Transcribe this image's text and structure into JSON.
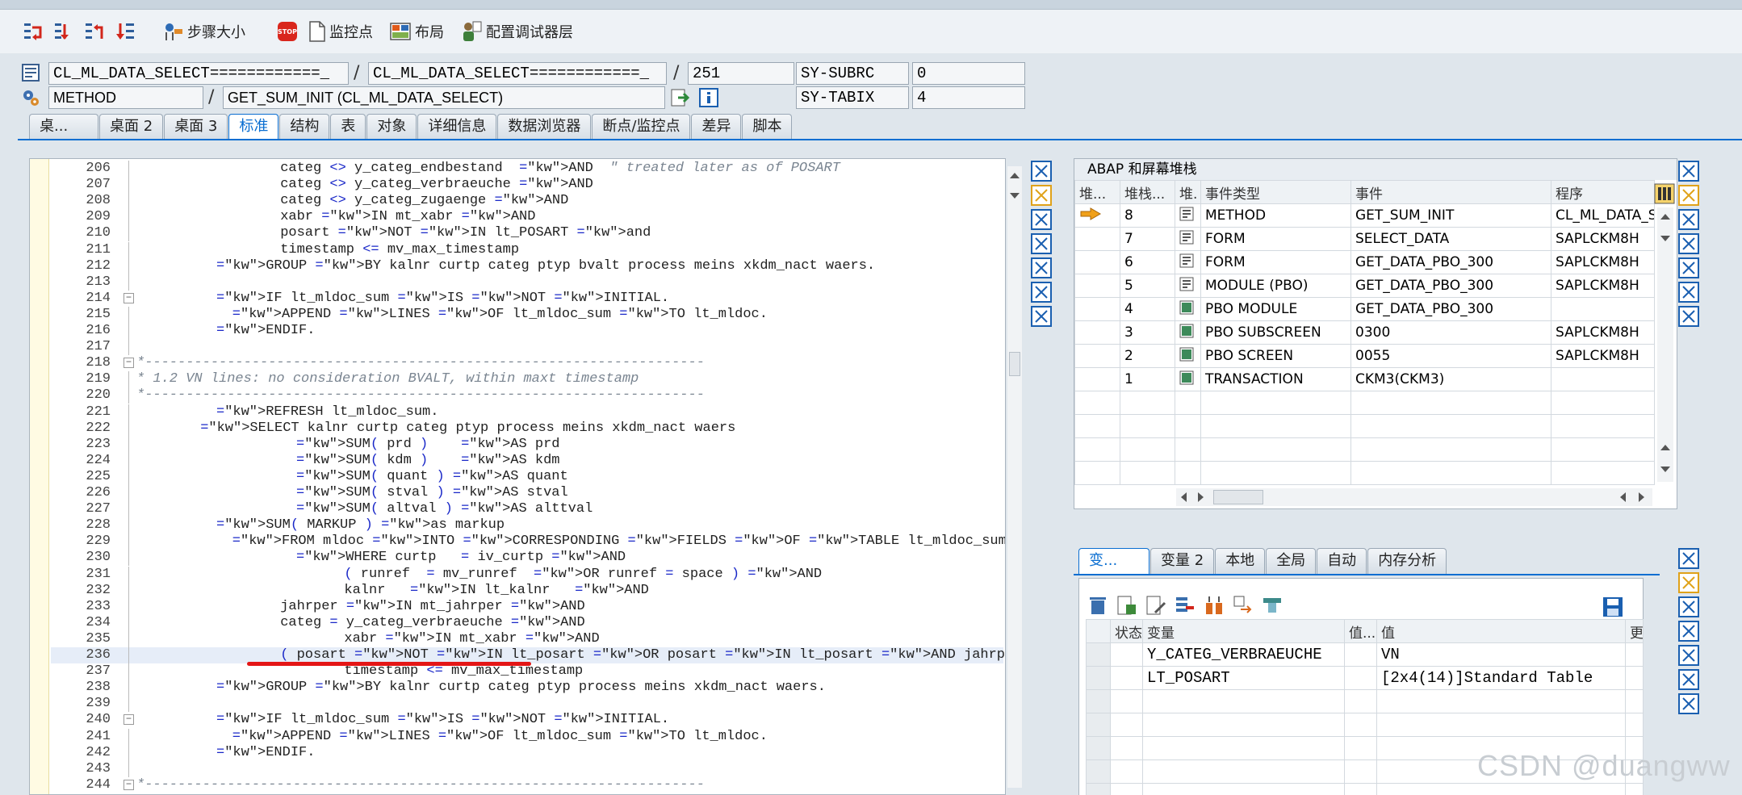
{
  "toolbar": {
    "step_size_label": "步骤大小",
    "stop_label": "STOP",
    "watchpoint_label": "监控点",
    "layout_label": "布局",
    "config_label": "配置调试器层"
  },
  "header": {
    "program_main": "CL_ML_DATA_SELECT============_",
    "program_include": "CL_ML_DATA_SELECT============_",
    "line_no": "251",
    "sysfield1_name": "SY-SUBRC",
    "sysfield1_value": "0",
    "event_type": "METHOD",
    "event_name": "GET_SUM_INIT (CL_ML_DATA_SELECT)",
    "sysfield2_name": "SY-TABIX",
    "sysfield2_value": "4"
  },
  "main_tabs": [
    "桌...",
    "桌面 2",
    "桌面 3",
    "标准",
    "结构",
    "表",
    "对象",
    "详细信息",
    "数据浏览器",
    "断点/监控点",
    "差异",
    "脚本"
  ],
  "code_lines": [
    {
      "n": "206",
      "t": "categ <> y_categ_endbestand  AND  \" treated later as of POSART"
    },
    {
      "n": "207",
      "t": "categ <> y_categ_verbraeuche AND"
    },
    {
      "n": "208",
      "t": "categ <> y_categ_zugaenge AND"
    },
    {
      "n": "209",
      "t": "xabr IN mt_xabr AND"
    },
    {
      "n": "210",
      "t": "posart NOT IN lt_POSART and"
    },
    {
      "n": "211",
      "t": "timestamp <= mv_max_timestamp"
    },
    {
      "n": "212",
      "t": "GROUP BY kalnr curtp categ ptyp bvalt process meins xkdm_nact waers."
    },
    {
      "n": "213",
      "t": ""
    },
    {
      "n": "214",
      "t": "IF lt_mldoc_sum IS NOT INITIAL."
    },
    {
      "n": "215",
      "t": "APPEND LINES OF lt_mldoc_sum TO lt_mldoc."
    },
    {
      "n": "216",
      "t": "ENDIF."
    },
    {
      "n": "217",
      "t": ""
    },
    {
      "n": "218",
      "t": "*--------------------------------------------------------------------"
    },
    {
      "n": "219",
      "t": "* 1.2 VN lines: no consideration BVALT, within maxt timestamp"
    },
    {
      "n": "220",
      "t": "*--------------------------------------------------------------------"
    },
    {
      "n": "221",
      "t": "REFRESH lt_mldoc_sum."
    },
    {
      "n": "222",
      "t": "SELECT kalnr curtp categ ptyp process meins xkdm_nact waers"
    },
    {
      "n": "223",
      "t": "SUM( prd )    AS prd"
    },
    {
      "n": "224",
      "t": "SUM( kdm )    AS kdm"
    },
    {
      "n": "225",
      "t": "SUM( quant ) AS quant"
    },
    {
      "n": "226",
      "t": "SUM( stval ) AS stval"
    },
    {
      "n": "227",
      "t": "SUM( altval ) AS alttval"
    },
    {
      "n": "228",
      "t": "SUM( MARKUP ) as markup"
    },
    {
      "n": "229",
      "t": "FROM mldoc INTO CORRESPONDING FIELDS OF TABLE lt_mldoc_sum"
    },
    {
      "n": "230",
      "t": "WHERE curtp   = iv_curtp AND"
    },
    {
      "n": "231",
      "t": "( runref  = mv_runref  OR runref = space ) AND"
    },
    {
      "n": "232",
      "t": "kalnr   IN lt_kalnr   AND"
    },
    {
      "n": "233",
      "t": "jahrper IN mt_jahrper AND"
    },
    {
      "n": "234",
      "t": "categ = y_categ_verbraeuche AND"
    },
    {
      "n": "235",
      "t": "xabr IN mt_xabr AND"
    },
    {
      "n": "236",
      "t": "( posart NOT IN lt_posart OR posart IN lt_posart AND jahrper_wip IN mt_jahrper ) AND"
    },
    {
      "n": "237",
      "t": "timestamp <= mv_max_timestamp"
    },
    {
      "n": "238",
      "t": "GROUP BY kalnr curtp categ ptyp process meins xkdm_nact waers."
    },
    {
      "n": "239",
      "t": ""
    },
    {
      "n": "240",
      "t": "IF lt_mldoc_sum IS NOT INITIAL."
    },
    {
      "n": "241",
      "t": "APPEND LINES OF lt_mldoc_sum TO lt_mldoc."
    },
    {
      "n": "242",
      "t": "ENDIF."
    },
    {
      "n": "243",
      "t": ""
    },
    {
      "n": "244",
      "t": "*--------------------------------------------------------------------"
    }
  ],
  "stack": {
    "title": "ABAP 和屏幕堆栈",
    "headers": [
      "堆...",
      "堆栈...",
      "堆.",
      "事件类型",
      "事件",
      "程序"
    ],
    "rows": [
      {
        "level": "8",
        "type": "METHOD",
        "event": "GET_SUM_INIT",
        "program": "CL_ML_DATA_S"
      },
      {
        "level": "7",
        "type": "FORM",
        "event": "SELECT_DATA",
        "program": "SAPLCKM8H"
      },
      {
        "level": "6",
        "type": "FORM",
        "event": "GET_DATA_PBO_300",
        "program": "SAPLCKM8H"
      },
      {
        "level": "5",
        "type": "MODULE (PBO)",
        "event": "GET_DATA_PBO_300",
        "program": "SAPLCKM8H"
      },
      {
        "level": "4",
        "type": "PBO MODULE",
        "event": "GET_DATA_PBO_300",
        "program": ""
      },
      {
        "level": "3",
        "type": "PBO SUBSCREEN",
        "event": "0300",
        "program": "SAPLCKM8H"
      },
      {
        "level": "2",
        "type": "PBO SCREEN",
        "event": "0055",
        "program": "SAPLCKM8H"
      },
      {
        "level": "1",
        "type": "TRANSACTION",
        "event": "CKM3(CKM3)",
        "program": ""
      }
    ]
  },
  "var_tabs": [
    "变...",
    "变量 2",
    "本地",
    "全局",
    "自动",
    "内存分析"
  ],
  "vars": {
    "headers": [
      "状态",
      "变量",
      "值...",
      "值",
      "更"
    ],
    "rows": [
      {
        "name": "Y_CATEG_VERBRAEUCHE",
        "value": "VN"
      },
      {
        "name": "LT_POSART",
        "value": "[2x4(14)]Standard Table"
      }
    ]
  },
  "watermark": "CSDN @duangww"
}
